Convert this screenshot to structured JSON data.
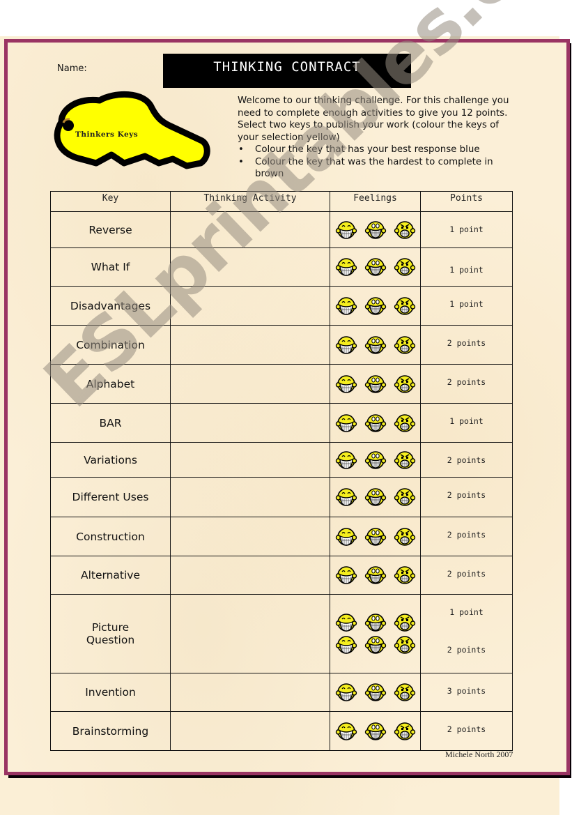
{
  "header": {
    "name_label": "Name:",
    "title": "THINKING CONTRACT",
    "logo_text": "Thinkers Keys"
  },
  "intro": {
    "paragraph": "Welcome to our thinking challenge.  For this challenge you need to complete enough activities to give you 12 points. Select two keys to publish your work (colour the keys of your selection yellow)",
    "bullets": [
      "Colour the key that has your best response blue",
      "Colour the key that was the hardest to complete in brown"
    ]
  },
  "table": {
    "headers": [
      "Key",
      "Thinking Activity",
      "Feelings",
      "Points"
    ],
    "feeling_icons": [
      "happy-face-icon",
      "ok-face-icon",
      "angry-face-icon"
    ],
    "rows": [
      {
        "key": "Reverse",
        "activity": "",
        "points": "1 point"
      },
      {
        "key": "What If",
        "activity": "",
        "points": "1 point"
      },
      {
        "key": "Disadvantages",
        "activity": "",
        "points": "1 point"
      },
      {
        "key": "Combination",
        "activity": "",
        "points": "2 points"
      },
      {
        "key": "Alphabet",
        "activity": "",
        "points": "2 points"
      },
      {
        "key": "BAR",
        "activity": "",
        "points": "1 point"
      },
      {
        "key": "Variations",
        "activity": "",
        "points": "2 points"
      },
      {
        "key": "Different Uses",
        "activity": "",
        "points": "2 points"
      },
      {
        "key": "Construction",
        "activity": "",
        "points": "2 points"
      },
      {
        "key": "Alternative",
        "activity": "",
        "points": "2 points"
      },
      {
        "key": "Picture",
        "activity": "",
        "points": "1 point"
      },
      {
        "key": "Question",
        "activity": "",
        "points": "2 points"
      },
      {
        "key": "Invention",
        "activity": "",
        "points": "3 points"
      },
      {
        "key": "Brainstorming",
        "activity": "",
        "points": "2 points"
      }
    ]
  },
  "footer": {
    "signature": "Michele North 2007"
  },
  "watermark": "ESLprintables.com",
  "colors": {
    "frame": "#9a3463",
    "key_fill": "#ffff00",
    "face_fill": "#f5ee1e",
    "title_bg": "#000000"
  }
}
